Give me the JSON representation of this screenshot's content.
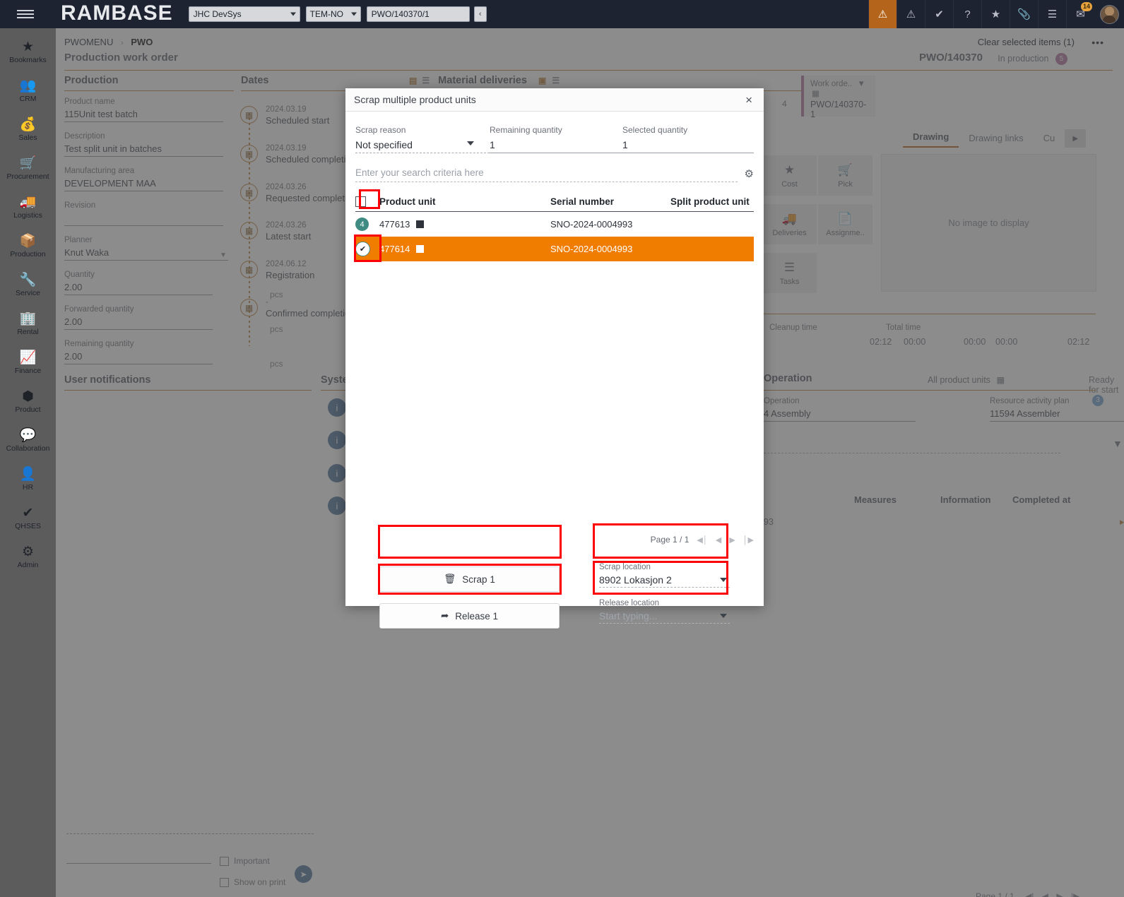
{
  "topbar": {
    "menu_icon": "hamburger-icon",
    "brand": "RAMBASE",
    "company_selector": "JHC DevSys",
    "location_selector": "TEM-NO",
    "search_value": "PWO/140370/1",
    "collapse_label": "‹",
    "icons": [
      {
        "name": "warning-icon",
        "glyph": "⚠"
      },
      {
        "name": "alert-icon",
        "glyph": "ⓘ"
      },
      {
        "name": "verified-icon",
        "glyph": "✔"
      },
      {
        "name": "help-icon",
        "glyph": "?"
      },
      {
        "name": "favorites-star-icon",
        "glyph": "★"
      },
      {
        "name": "attachment-icon",
        "glyph": "ὌE"
      },
      {
        "name": "list-icon",
        "glyph": "☰"
      },
      {
        "name": "mail-icon",
        "glyph": "✉"
      }
    ],
    "mail_badge": "14"
  },
  "rail": {
    "items": [
      {
        "label": "Bookmarks",
        "icon": "star-icon",
        "glyph": "★"
      },
      {
        "label": "CRM",
        "icon": "people-icon",
        "glyph": "👥"
      },
      {
        "label": "Sales",
        "icon": "money-bag-icon",
        "glyph": "💰"
      },
      {
        "label": "Procurement",
        "icon": "shopping-cart-icon",
        "glyph": "🛒"
      },
      {
        "label": "Logistics",
        "icon": "truck-icon",
        "glyph": "🚚"
      },
      {
        "label": "Production",
        "icon": "boxes-icon",
        "glyph": "📦"
      },
      {
        "label": "Service",
        "icon": "wrench-icon",
        "glyph": "🔧"
      },
      {
        "label": "Rental",
        "icon": "rental-building-icon",
        "glyph": "🏢"
      },
      {
        "label": "Finance",
        "icon": "chart-line-icon",
        "glyph": "📈"
      },
      {
        "label": "Product",
        "icon": "cube-icon",
        "glyph": "📦"
      },
      {
        "label": "Collaboration",
        "icon": "chat-bubbles-icon",
        "glyph": "💬"
      },
      {
        "label": "HR",
        "icon": "person-icon",
        "glyph": "👤"
      },
      {
        "label": "QHSES",
        "icon": "badge-check-icon",
        "glyph": "✔"
      },
      {
        "label": "Admin",
        "icon": "gear-icon",
        "glyph": "⚙"
      }
    ]
  },
  "background": {
    "breadcrumb_root": "PWOMENU",
    "breadcrumb_sep": "›",
    "breadcrumb_current": "PWO",
    "clear_selected": "Clear selected items (1)",
    "dots": "•••",
    "page_title": "Production work order",
    "doc_id": "PWO/140370",
    "doc_status": "In production",
    "doc_status_count": "5",
    "sections": {
      "production": "Production",
      "dates": "Dates",
      "material_deliveries": "Material deliveries",
      "user_notifications": "User notifications",
      "system_notifications": "System",
      "operation": "Operation"
    },
    "fields": [
      {
        "label": "Product name",
        "value": "115Unit test batch"
      },
      {
        "label": "Description",
        "value": "Test split unit in batches"
      },
      {
        "label": "Manufacturing area",
        "value": "DEVELOPMENT MAA"
      },
      {
        "label": "Revision",
        "value": ""
      },
      {
        "label": "Planner",
        "value": "Knut Waka"
      },
      {
        "label": "Quantity",
        "value": "2.00",
        "unit": "pcs"
      },
      {
        "label": "Forwarded quantity",
        "value": "2.00",
        "unit": "pcs"
      },
      {
        "label": "Remaining quantity",
        "value": "2.00",
        "unit": "pcs"
      }
    ],
    "timeline": [
      {
        "date": "2024.03.19",
        "label": "Scheduled start"
      },
      {
        "date": "2024.03.19",
        "label": "Scheduled completion"
      },
      {
        "date": "2024.03.26",
        "label": "Requested completion"
      },
      {
        "date": "2024.03.26",
        "label": "Latest start"
      },
      {
        "date": "2024.06.12",
        "label": "Registration"
      },
      {
        "date": "-",
        "label": "Confirmed completion"
      }
    ],
    "work_order_card": {
      "title": "Work orde..",
      "value": "PWO/140370-1",
      "count": "4"
    },
    "tabs": [
      {
        "label": "Drawing",
        "active": true
      },
      {
        "label": "Drawing links",
        "active": false
      },
      {
        "label": "Cu",
        "active": false
      }
    ],
    "tab_next": "▶",
    "tools": [
      {
        "label": "Cost",
        "icon": "money-bag-icon",
        "glyph": "💰"
      },
      {
        "label": "Pick",
        "icon": "cart-icon",
        "glyph": "🛒"
      },
      {
        "label": "Deliveries",
        "icon": "truck-icon",
        "glyph": "🚚"
      },
      {
        "label": "Assignme..",
        "icon": "document-icon",
        "glyph": "📄"
      },
      {
        "label": "Tasks",
        "icon": "task-list-icon",
        "glyph": "☰"
      }
    ],
    "no_image": "No image to display",
    "times": [
      {
        "label": "",
        "value": "02:12"
      },
      {
        "label": "Cleanup time",
        "value": "00:00"
      },
      {
        "label": "",
        "value": "00:00"
      },
      {
        "label": "Total time",
        "value": "00:00"
      },
      {
        "label": "",
        "value": "02:12"
      }
    ],
    "operation_header": {
      "all_product_units": "All product units",
      "status": "Ready for start",
      "status_count": "3"
    },
    "operation_fields": [
      {
        "label": "Operation",
        "value": "4 Assembly"
      },
      {
        "label": "Resource activity plan",
        "value": "11594 Assembler"
      }
    ],
    "operation_table_headers": [
      "Measures",
      "Information",
      "Completed at"
    ],
    "operation_row_value": "93",
    "notification_checkboxes": [
      "Important",
      "Show on print"
    ],
    "bottom_pager": "Page 1 / 1"
  },
  "modal": {
    "title": "Scrap multiple product units",
    "close_label": "×",
    "fields": {
      "scrap_reason": {
        "label": "Scrap reason",
        "value": "Not specified"
      },
      "remaining_quantity": {
        "label": "Remaining quantity",
        "value": "1"
      },
      "selected_quantity": {
        "label": "Selected quantity",
        "value": "1"
      }
    },
    "search_placeholder": "Enter your search criteria here",
    "settings_icon": "gear-icon",
    "table": {
      "headers": [
        "Product unit",
        "Serial number",
        "Split product unit"
      ],
      "rows": [
        {
          "badge": "4",
          "badge_type": "count",
          "product_unit": "477613",
          "serial_number": "SNO-2024-0004993",
          "split_product_unit": "",
          "selected": false
        },
        {
          "badge": "✔",
          "badge_type": "check",
          "product_unit": "477614",
          "serial_number": "SNO-2024-0004993",
          "split_product_unit": "",
          "selected": true
        }
      ]
    },
    "pager": {
      "label": "Page 1 / 1",
      "first": "◀│",
      "prev": "◀",
      "next": "▶",
      "last": "│▶"
    },
    "actions": {
      "scrap": "Scrap 1",
      "scrap_icon": "trash-icon",
      "release": "Release 1",
      "release_icon": "share-arrow-icon"
    },
    "locations": {
      "scrap_location": {
        "label": "Scrap location",
        "value": "8902 Lokasjon 2"
      },
      "release_location": {
        "label": "Release location",
        "value": "Start typing..."
      }
    }
  },
  "colors": {
    "brand_accent": "#d4762a",
    "selected_row": "#f07d00",
    "highlight_box": "#fb0007",
    "topbar_bg": "#1d2331",
    "rail_bg": "#5c5c5c",
    "badge_teal": "#3f8b83"
  }
}
